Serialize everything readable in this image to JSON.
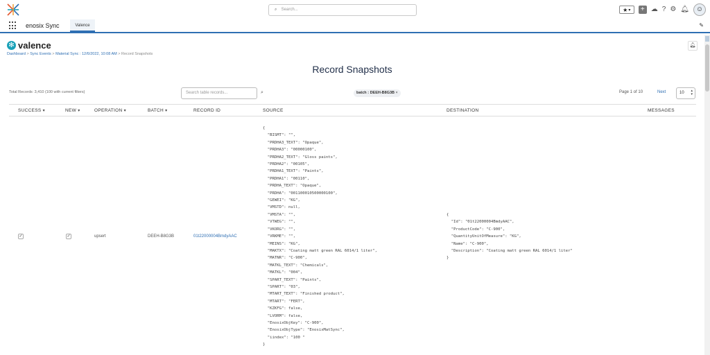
{
  "topbar": {
    "search_placeholder": "Search...",
    "icons": [
      "star-icon",
      "plus-icon",
      "cloud-icon",
      "help-icon",
      "gear-icon",
      "bell-icon",
      "avatar"
    ]
  },
  "navbar": {
    "app_name": "enosix Sync",
    "tab_label": "Valence"
  },
  "page": {
    "brand": "valence",
    "breadcrumbs": [
      {
        "label": "Dashboard",
        "link": true
      },
      {
        "label": "Sync Events",
        "link": true
      },
      {
        "label": "Material Sync : 12/6/2022, 10:08 AM",
        "link": true
      },
      {
        "label": "Record Snapshots",
        "link": false
      }
    ],
    "title": "Record Snapshots"
  },
  "toolbar": {
    "total_records": "Total Records: 3,410 (100 with current filters)",
    "table_search_placeholder": "Search table records...",
    "filter_pill_key": "batch :",
    "filter_pill_value": "DEEH-B8G3B",
    "filter_pill_close": "×",
    "page_info": "Page 1 of 10",
    "next_label": "Next",
    "per_page": "10"
  },
  "table": {
    "headers": {
      "success": "SUCCESS",
      "new": "NEW",
      "operation": "OPERATION",
      "batch": "BATCH",
      "record_id": "RECORD ID",
      "source": "SOURCE",
      "destination": "DESTINATION",
      "messages": "MESSAGES"
    },
    "rows": [
      {
        "success": true,
        "new": true,
        "operation": "upsert",
        "batch": "DEEH-B8G3B",
        "record_id": "01t22000004BmdyAAC",
        "source": "{\n  \"BISMT\": \"\",\n  \"PRDHA3_TEXT\": \"Opaque\",\n  \"PRDHA3\": \"00000100\",\n  \"PRDHA2_TEXT\": \"Gloss paints\",\n  \"PRDHA2\": \"00105\",\n  \"PRDHA1_TEXT\": \"Paints\",\n  \"PRDHA1\": \"00110\",\n  \"PRDHA_TEXT\": \"Opaque\",\n  \"PRDHA\": \"001100010500000100\",\n  \"GEWEI\": \"KG\",\n  \"VMSTD\": null,\n  \"VMSTA\": \"\",\n  \"VTWEG\": \"\",\n  \"VKORG\": \"\",\n  \"VRKME\": \"\",\n  \"MEINS\": \"KG\",\n  \"MAKTX\": \"Coating matt green RAL 6014/1 liter\",\n  \"MATNR\": \"C-900\",\n  \"MATKL_TEXT\": \"Chemicals\",\n  \"MATKL\": \"004\",\n  \"SPART_TEXT\": \"Paints\",\n  \"SPART\": \"03\",\n  \"MTART_TEXT\": \"Finished product\",\n  \"MTART\": \"FERT\",\n  \"KZKFG\": false,\n  \"LVORM\": false,\n  \"EnosixObjKey\": \"C-900\",\n  \"EnosixObjType\": \"EnosixMatSync\",\n  \"iindex\": \"100 \"\n}",
        "destination": "{\n  \"Id\": \"01t22000004BmdyAAC\",\n  \"ProductCode\": \"C-900\",\n  \"QuantityUnitOfMeasure\": \"KG\",\n  \"Name\": \"C-900\",\n  \"Description\": \"Coating matt green RAL 6014/1 liter\"\n}",
        "messages": ""
      }
    ]
  },
  "colors": {
    "accent": "#2f6fb3",
    "brand_teal": "#19a1b8",
    "title": "#22304a"
  }
}
